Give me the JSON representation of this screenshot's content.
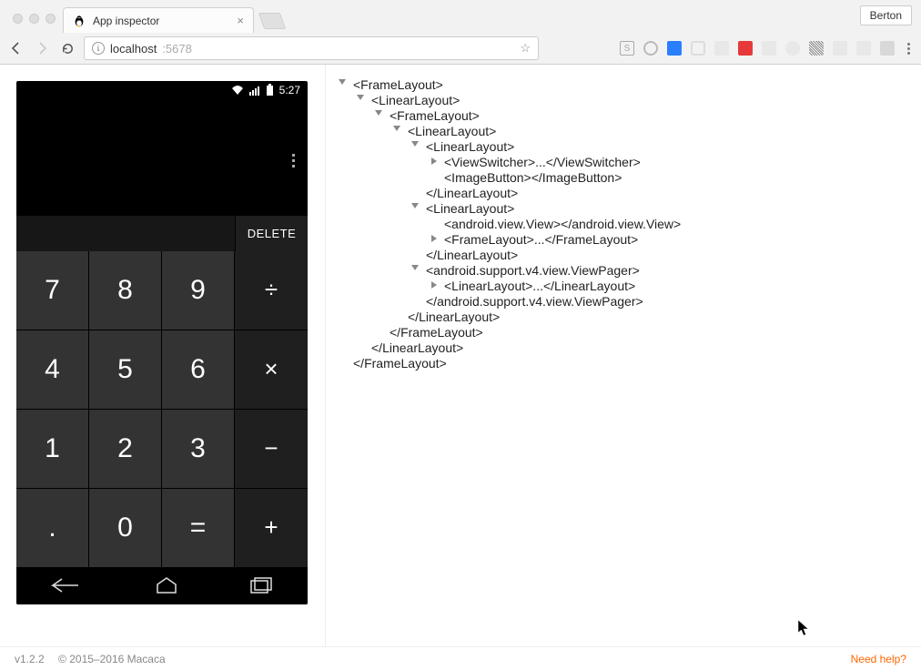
{
  "browser": {
    "tab_title": "App inspector",
    "profile": "Berton",
    "url_host": "localhost",
    "url_port": ":5678"
  },
  "device": {
    "time": "5:27",
    "delete_label": "DELETE",
    "buttons": {
      "r0c0": "7",
      "r0c1": "8",
      "r0c2": "9",
      "r0c3": "÷",
      "r1c0": "4",
      "r1c1": "5",
      "r1c2": "6",
      "r1c3": "×",
      "r2c0": "1",
      "r2c1": "2",
      "r2c2": "3",
      "r2c3": "−",
      "r3c0": ".",
      "r3c1": "0",
      "r3c2": "=",
      "r3c3": "+"
    }
  },
  "tree": {
    "n0": "<FrameLayout>",
    "n1": "<LinearLayout>",
    "n2": "<FrameLayout>",
    "n3": "<LinearLayout>",
    "n4": "<LinearLayout>",
    "n5": "<ViewSwitcher>...</ViewSwitcher>",
    "n6": "<ImageButton></ImageButton>",
    "n7": "</LinearLayout>",
    "n8": "<LinearLayout>",
    "n9": "<android.view.View></android.view.View>",
    "n10": "<FrameLayout>...</FrameLayout>",
    "n11": "</LinearLayout>",
    "n12": "<android.support.v4.view.ViewPager>",
    "n13": "<LinearLayout>...</LinearLayout>",
    "n14": "</android.support.v4.view.ViewPager>",
    "n15": "</LinearLayout>",
    "n16": "</FrameLayout>",
    "n17": "</LinearLayout>",
    "n18": "</FrameLayout>"
  },
  "footer": {
    "version": "v1.2.2",
    "copyright": "© 2015–2016 Macaca",
    "help": "Need help?"
  }
}
